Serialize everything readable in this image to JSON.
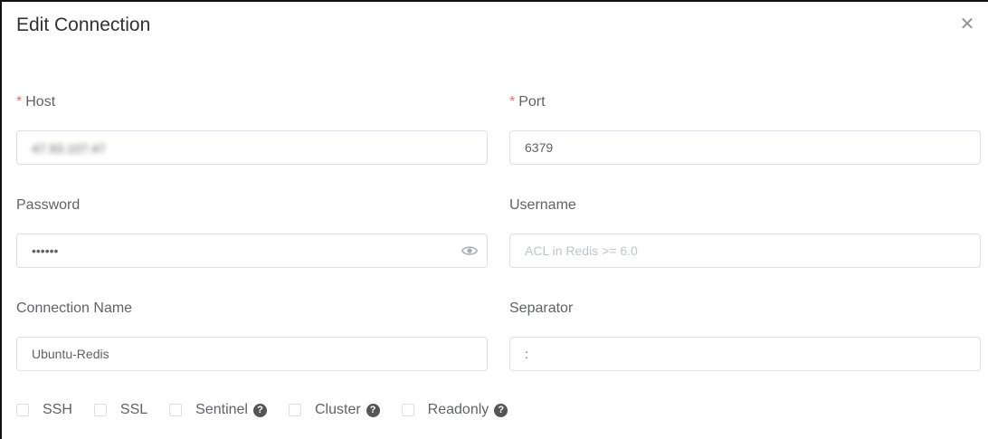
{
  "dialog": {
    "title": "Edit Connection"
  },
  "host": {
    "label": "Host",
    "required_mark": "*",
    "value": "47.93.107.47"
  },
  "port": {
    "label": "Port",
    "required_mark": "*",
    "value": "6379"
  },
  "password": {
    "label": "Password",
    "value": "••••••"
  },
  "username": {
    "label": "Username",
    "value": "",
    "placeholder": "ACL in Redis >= 6.0"
  },
  "connection_name": {
    "label": "Connection Name",
    "value": "Ubuntu-Redis"
  },
  "separator": {
    "label": "Separator",
    "value": ":"
  },
  "options": [
    {
      "label": "SSH",
      "checked": false,
      "help": false
    },
    {
      "label": "SSL",
      "checked": false,
      "help": false
    },
    {
      "label": "Sentinel",
      "checked": false,
      "help": true
    },
    {
      "label": "Cluster",
      "checked": false,
      "help": true
    },
    {
      "label": "Readonly",
      "checked": false,
      "help": true
    }
  ],
  "icons": {
    "close": "close-icon",
    "eye": "eye-icon",
    "help": "question-circle-icon"
  },
  "colors": {
    "required": "#f56c6c",
    "border": "#dcdfe6",
    "placeholder": "#c0c4cc"
  }
}
